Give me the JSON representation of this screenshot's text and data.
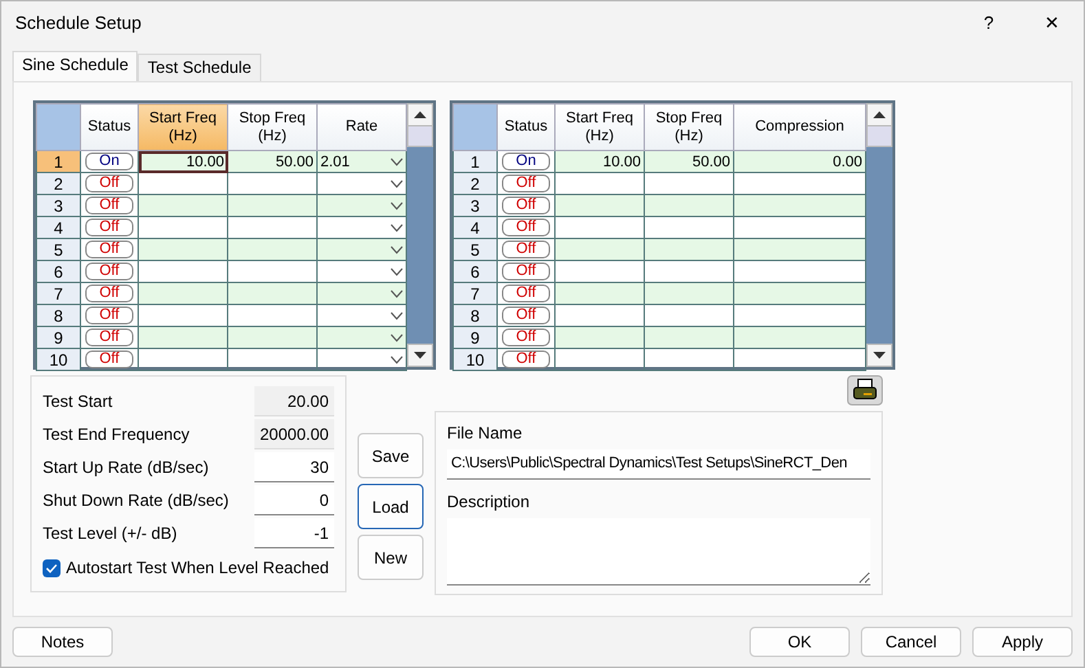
{
  "window": {
    "title": "Schedule Setup",
    "help": "?",
    "close": "✕"
  },
  "tabs": [
    {
      "label": "Sine Schedule",
      "selected": true
    },
    {
      "label": "Test Schedule",
      "selected": false
    }
  ],
  "sine_grid": {
    "columns": [
      {
        "label": "Status",
        "selected": false
      },
      {
        "label": "Start Freq (Hz)",
        "selected": true
      },
      {
        "label": "Stop Freq (Hz)",
        "selected": false
      },
      {
        "label": "Rate",
        "selected": false
      }
    ],
    "rows": [
      {
        "num": "1",
        "status": "On",
        "on": true,
        "selected": true,
        "start_freq": "10.00",
        "stop_freq": "50.00",
        "rate": "2.01"
      },
      {
        "num": "2",
        "status": "Off",
        "on": false,
        "selected": false
      },
      {
        "num": "3",
        "status": "Off",
        "on": false,
        "selected": false
      },
      {
        "num": "4",
        "status": "Off",
        "on": false,
        "selected": false
      },
      {
        "num": "5",
        "status": "Off",
        "on": false,
        "selected": false
      },
      {
        "num": "6",
        "status": "Off",
        "on": false,
        "selected": false
      },
      {
        "num": "7",
        "status": "Off",
        "on": false,
        "selected": false
      },
      {
        "num": "8",
        "status": "Off",
        "on": false,
        "selected": false
      },
      {
        "num": "9",
        "status": "Off",
        "on": false,
        "selected": false
      },
      {
        "num": "10",
        "status": "Off",
        "on": false,
        "selected": false
      }
    ]
  },
  "compression_grid": {
    "columns": [
      {
        "label": "Status",
        "selected": false
      },
      {
        "label": "Start Freq (Hz)",
        "selected": false
      },
      {
        "label": "Stop Freq (Hz)",
        "selected": false
      },
      {
        "label": "Compression",
        "selected": false
      }
    ],
    "rows": [
      {
        "num": "1",
        "status": "On",
        "on": true,
        "selected": false,
        "start_freq": "10.00",
        "stop_freq": "50.00",
        "compression": "0.00"
      },
      {
        "num": "2",
        "status": "Off",
        "on": false,
        "selected": false
      },
      {
        "num": "3",
        "status": "Off",
        "on": false,
        "selected": false
      },
      {
        "num": "4",
        "status": "Off",
        "on": false,
        "selected": false
      },
      {
        "num": "5",
        "status": "Off",
        "on": false,
        "selected": false
      },
      {
        "num": "6",
        "status": "Off",
        "on": false,
        "selected": false
      },
      {
        "num": "7",
        "status": "Off",
        "on": false,
        "selected": false
      },
      {
        "num": "8",
        "status": "Off",
        "on": false,
        "selected": false
      },
      {
        "num": "9",
        "status": "Off",
        "on": false,
        "selected": false
      },
      {
        "num": "10",
        "status": "Off",
        "on": false,
        "selected": false
      }
    ]
  },
  "settings": [
    {
      "label": "Test Start",
      "value": "20.00",
      "readonly": true
    },
    {
      "label": "Test End Frequency",
      "value": "20000.00",
      "readonly": true
    },
    {
      "label": "Start Up Rate (dB/sec)",
      "value": "30",
      "readonly": false
    },
    {
      "label": "Shut Down Rate (dB/sec)",
      "value": "0",
      "readonly": false
    },
    {
      "label": "Test Level (+/- dB)",
      "value": "-1",
      "readonly": false
    }
  ],
  "autostart": {
    "label": "Autostart Test When Level Reached",
    "checked": true
  },
  "file_buttons": [
    {
      "label": "Save",
      "focused": false
    },
    {
      "label": "Load",
      "focused": true
    },
    {
      "label": "New",
      "focused": false
    }
  ],
  "file_name": {
    "label": "File Name",
    "value": "C:\\Users\\Public\\Spectral Dynamics\\Test Setups\\SineRCT_Den"
  },
  "description": {
    "label": "Description"
  },
  "footer_left": "Notes",
  "footer_buttons": [
    "OK",
    "Cancel",
    "Apply"
  ]
}
